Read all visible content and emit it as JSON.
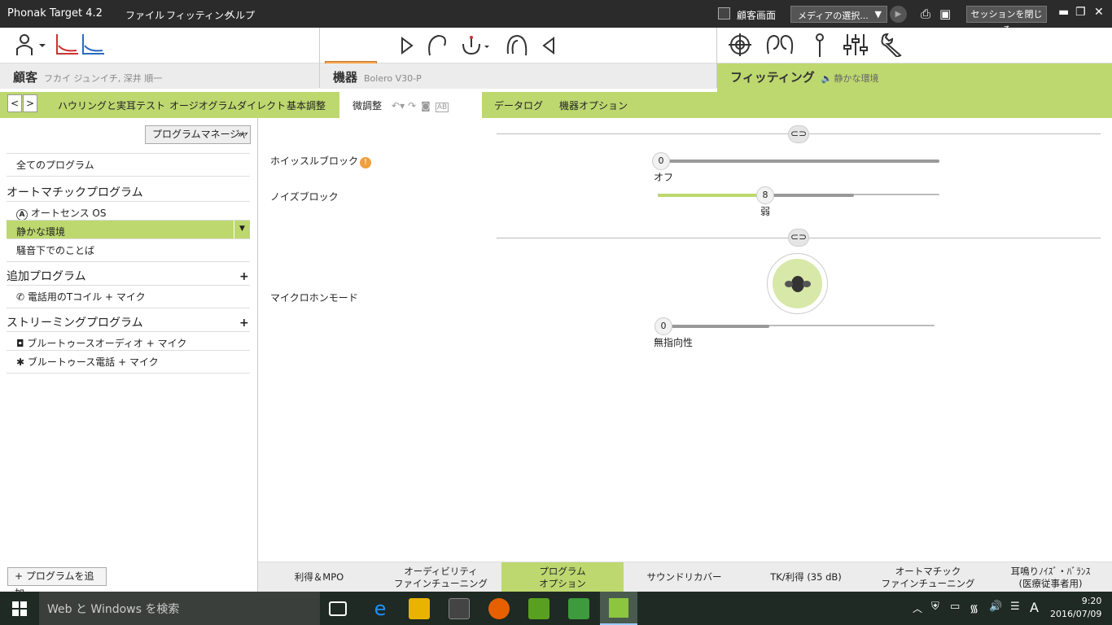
{
  "titlebar": {
    "app_title": "Phonak Target 4.2",
    "menus": [
      "ファイル",
      "フィッティング",
      "ヘルプ"
    ],
    "client_screen": "顧客画面",
    "media_select": "メディアの選択...",
    "end_session": "セッションを閉じる"
  },
  "toolbar": {
    "connect": "接続"
  },
  "sections": {
    "client": "顧客",
    "client_name": "フカイ ジュンイチ, 深井 順一",
    "device": "機器",
    "device_name": "Bolero V30-P",
    "fitting": "フィッティング",
    "fitting_sub": "静かな環境"
  },
  "tabs": [
    "ハウリングと実耳テスト",
    "オージオグラムダイレクト",
    "基本調整",
    "微調整",
    "データログ",
    "機器オプション"
  ],
  "sidebar": {
    "program_manager": "プログラムマネージャ",
    "all_programs": "全てのプログラム",
    "auto_group": "オートマチックプログラム",
    "autosense": "オートセンス OS",
    "quiet": "静かな環境",
    "noisy": "騒音下でのことば",
    "extra_group": "追加プログラム",
    "tcoil": "電話用のTコイル + マイク",
    "stream_group": "ストリーミングプログラム",
    "bt_audio": "ブルートゥースオーディオ + マイク",
    "bt_phone": "ブルートゥース電話 + マイク",
    "add_program": "プログラムを追加..."
  },
  "main": {
    "whistle_label": "ホイッスルブロック",
    "whistle_value": "0",
    "whistle_text": "オフ",
    "noise_label": "ノイズブロック",
    "noise_value": "8",
    "noise_text": "弱",
    "mic_label": "マイクロホンモード",
    "mic_value": "0",
    "mic_text": "無指向性",
    "noise_level": 0.8,
    "mic_level": 0.0
  },
  "bottom_tabs": [
    {
      "l1": "利得＆MPO",
      "l2": ""
    },
    {
      "l1": "オーディビリティ",
      "l2": "ファインチューニング"
    },
    {
      "l1": "プログラム",
      "l2": "オプション"
    },
    {
      "l1": "サウンドリカバー",
      "l2": ""
    },
    {
      "l1": "TK/利得 (35 dB)",
      "l2": ""
    },
    {
      "l1": "オートマチック",
      "l2": "ファインチューニング"
    },
    {
      "l1": "耳鳴りﾉｲｽﾞ・ﾊﾞﾗﾝｽ",
      "l2": "(医療従事者用)"
    }
  ],
  "taskbar": {
    "search": "Web と Windows を検索",
    "time": "9:20",
    "date": "2016/07/09",
    "ime": "A"
  },
  "colors": {
    "accent_green": "#bdd86f",
    "connect_orange": "#f7a44c"
  }
}
